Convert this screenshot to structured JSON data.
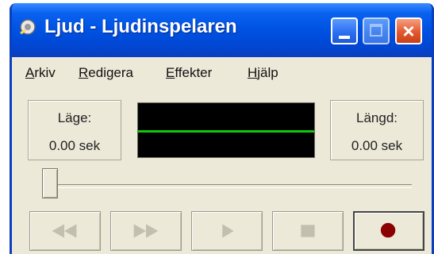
{
  "window": {
    "title": "Ljud - Ljudinspelaren"
  },
  "menu": {
    "items": [
      {
        "first": "A",
        "rest": "rkiv"
      },
      {
        "first": "R",
        "rest": "edigera"
      },
      {
        "first": "E",
        "rest": "ffekter"
      },
      {
        "first": "H",
        "rest": "jälp"
      }
    ]
  },
  "position": {
    "label": "Läge:",
    "value": "0.00 sek"
  },
  "length": {
    "label": "Längd:",
    "value": "0.00 sek"
  },
  "slider": {
    "value_fraction": 0.0
  },
  "transport": {
    "buttons": [
      {
        "icon": "rewind-icon",
        "enabled": false
      },
      {
        "icon": "fast-forward-icon",
        "enabled": false
      },
      {
        "icon": "play-icon",
        "enabled": false
      },
      {
        "icon": "stop-icon",
        "enabled": false
      },
      {
        "icon": "record-icon",
        "enabled": true
      }
    ]
  },
  "colors": {
    "title_bar": "#0054e3",
    "waveform_background": "#000000",
    "waveform_line": "#11c511",
    "record_dot": "#8b0000",
    "disabled_glyph": "#c2bfb1"
  }
}
